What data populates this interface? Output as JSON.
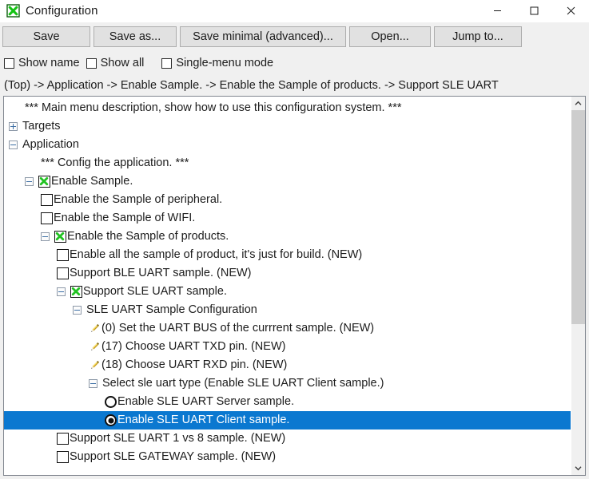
{
  "window": {
    "title": "Configuration",
    "icon": "green-x-checkbox-icon",
    "minimize_label": "─",
    "maximize_label": "□",
    "close_label": "✕"
  },
  "toolbar": {
    "buttons": [
      {
        "label": "Save",
        "name": "save-button"
      },
      {
        "label": "Save as...",
        "name": "save-as-button"
      },
      {
        "label": "Save minimal (advanced)...",
        "name": "save-minimal-button"
      },
      {
        "label": "Open...",
        "name": "open-button"
      },
      {
        "label": "Jump to...",
        "name": "jump-to-button"
      }
    ]
  },
  "options": [
    {
      "label": "Show name",
      "checked": false,
      "name": "show-name-checkbox"
    },
    {
      "label": "Show all",
      "checked": false,
      "name": "show-all-checkbox"
    },
    {
      "label": "Single-menu mode",
      "checked": false,
      "name": "single-menu-mode-checkbox"
    }
  ],
  "breadcrumb": {
    "text": "(Top) -> Application -> Enable Sample. -> Enable the Sample of products. -> Support SLE UART"
  },
  "colors": {
    "selection": "#0b78d0",
    "check_green": "#22c322",
    "pencil_gold": "#e8c23a",
    "window_bg": "#f0f0f0",
    "tree_bg": "#ffffff",
    "scrollbar_thumb": "#cdcdcd"
  },
  "tree": {
    "rows": [
      {
        "label": "*** Main menu description, show how to use this configuration system. ***",
        "indent": 1,
        "widget": "none",
        "expander": "none",
        "selected": false
      },
      {
        "label": "Targets",
        "indent": 0,
        "widget": "none",
        "expander": "plus",
        "selected": false
      },
      {
        "label": "Application",
        "indent": 0,
        "widget": "none",
        "expander": "minus",
        "selected": false
      },
      {
        "label": "*** Config the application. ***",
        "indent": 2,
        "widget": "none",
        "expander": "none",
        "selected": false
      },
      {
        "label": "Enable Sample.",
        "indent": 1,
        "widget": "checkbox",
        "checked": true,
        "expander": "minus",
        "selected": false
      },
      {
        "label": "Enable the Sample of peripheral.",
        "indent": 2,
        "widget": "checkbox",
        "checked": false,
        "expander": "none",
        "selected": false
      },
      {
        "label": "Enable the Sample of WIFI.",
        "indent": 2,
        "widget": "checkbox",
        "checked": false,
        "expander": "none",
        "selected": false
      },
      {
        "label": "Enable the Sample of products.",
        "indent": 2,
        "widget": "checkbox",
        "checked": true,
        "expander": "minus",
        "selected": false
      },
      {
        "label": "Enable all the sample of product, it's just for build. (NEW)",
        "indent": 3,
        "widget": "checkbox",
        "checked": false,
        "expander": "none",
        "selected": false
      },
      {
        "label": "Support BLE UART sample. (NEW)",
        "indent": 3,
        "widget": "checkbox",
        "checked": false,
        "expander": "none",
        "selected": false
      },
      {
        "label": "Support SLE UART sample.",
        "indent": 3,
        "widget": "checkbox",
        "checked": true,
        "expander": "minus",
        "selected": false
      },
      {
        "label": "SLE UART Sample Configuration",
        "indent": 4,
        "widget": "none",
        "expander": "minus",
        "selected": false
      },
      {
        "label": "(0) Set the UART BUS of the currrent sample. (NEW)",
        "indent": 5,
        "widget": "pencil",
        "expander": "none",
        "selected": false
      },
      {
        "label": "(17) Choose UART TXD pin. (NEW)",
        "indent": 5,
        "widget": "pencil",
        "expander": "none",
        "selected": false
      },
      {
        "label": "(18) Choose UART RXD pin. (NEW)",
        "indent": 5,
        "widget": "pencil",
        "expander": "none",
        "selected": false
      },
      {
        "label": "Select sle uart type (Enable SLE UART Client sample.)",
        "indent": 5,
        "widget": "none",
        "expander": "minus",
        "selected": false
      },
      {
        "label": "Enable SLE UART Server sample.",
        "indent": 6,
        "widget": "radio",
        "checked": false,
        "expander": "none",
        "selected": false
      },
      {
        "label": "Enable SLE UART Client sample.",
        "indent": 6,
        "widget": "radio",
        "checked": true,
        "expander": "none",
        "selected": true
      },
      {
        "label": "Support SLE UART 1 vs 8 sample. (NEW)",
        "indent": 3,
        "widget": "checkbox",
        "checked": false,
        "expander": "none",
        "selected": false
      },
      {
        "label": "Support SLE GATEWAY sample. (NEW)",
        "indent": 3,
        "widget": "checkbox",
        "checked": false,
        "expander": "none",
        "selected": false
      }
    ]
  },
  "scrollbar": {
    "up_arrow": "chevron-up-icon",
    "down_arrow": "chevron-down-icon",
    "thumb_top_percent": 0,
    "thumb_height_percent": 61
  }
}
